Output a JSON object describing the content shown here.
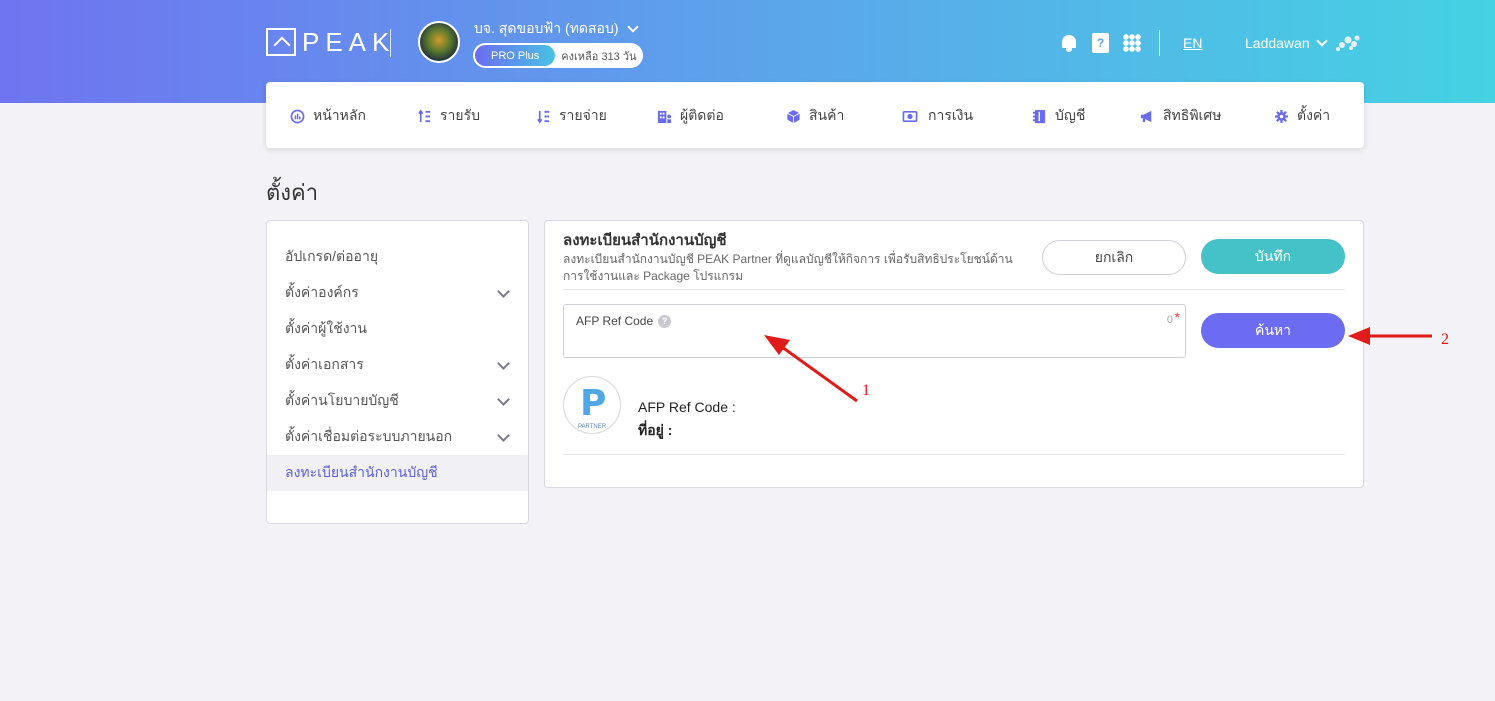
{
  "header": {
    "logo_text": "PEAK",
    "company_name": "บจ. สุดขอบฟ้า (ทดสอบ)",
    "plan_badge": "PRO Plus",
    "plan_remaining": "คงเหลือ 313 วัน",
    "language": "EN",
    "user_name": "Laddawan",
    "book_icon_glyph": "?"
  },
  "nav": {
    "items": [
      {
        "label": "หน้าหลัก",
        "icon": "dashboard-icon"
      },
      {
        "label": "รายรับ",
        "icon": "income-icon"
      },
      {
        "label": "รายจ่าย",
        "icon": "expense-icon"
      },
      {
        "label": "ผู้ติดต่อ",
        "icon": "contacts-icon"
      },
      {
        "label": "สินค้า",
        "icon": "product-icon"
      },
      {
        "label": "การเงิน",
        "icon": "money-icon"
      },
      {
        "label": "บัญชี",
        "icon": "ledger-icon"
      },
      {
        "label": "สิทธิพิเศษ",
        "icon": "megaphone-icon"
      },
      {
        "label": "ตั้งค่า",
        "icon": "gear-icon"
      }
    ]
  },
  "page": {
    "title": "ตั้งค่า"
  },
  "sidebar": {
    "items": [
      {
        "label": "อัปเกรด/ต่ออายุ"
      },
      {
        "label": "ตั้งค่าองค์กร"
      },
      {
        "label": "ตั้งค่าผู้ใช้งาน"
      },
      {
        "label": "ตั้งค่าเอกสาร"
      },
      {
        "label": "ตั้งค่านโยบายบัญชี"
      },
      {
        "label": "ตั้งค่าเชื่อมต่อระบบภายนอก"
      },
      {
        "label": "ลงทะเบียนสำนักงานบัญชี"
      }
    ]
  },
  "panel": {
    "title": "ลงทะเบียนสำนักงานบัญชี",
    "description": "ลงทะเบียนสำนักงานบัญชี PEAK Partner ที่ดูแลบัญชีให้กิจการ เพื่อรับสิทธิประโยชน์ด้านการใช้งานและ Package โปรแกรม",
    "cancel_label": "ยกเลิก",
    "save_label": "บันทึก",
    "field_label": "AFP Ref Code",
    "field_value": "",
    "field_counter": "0",
    "field_required": "*",
    "search_label": "ค้นหา",
    "partner_logo_text": "PARTNER",
    "result_ref_label": "AFP Ref Code :",
    "result_address_label": "ที่อยู่ :"
  },
  "annotations": {
    "arrow1_label": "1",
    "arrow2_label": "2",
    "color": "#e11a1a"
  },
  "colors": {
    "brand_gradient_start": "#6f74f0",
    "brand_gradient_end": "#45d2e3",
    "save_button": "#45c1c8",
    "search_button": "#6c6cf2",
    "active_sidebar_text": "#5c5fe0"
  }
}
